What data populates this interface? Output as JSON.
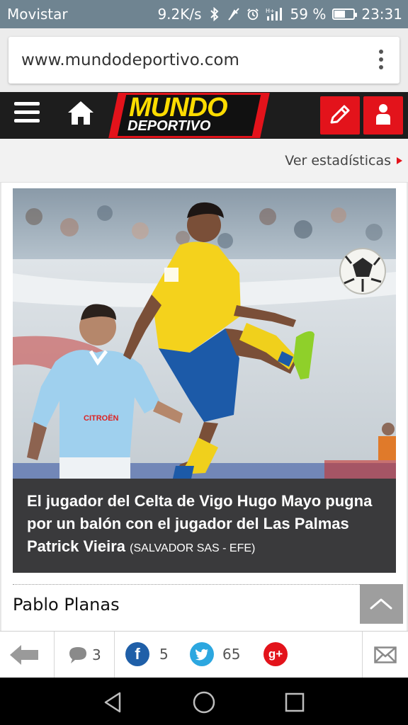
{
  "status_bar": {
    "carrier": "Movistar",
    "speed": "9.2K/s",
    "network": "H+",
    "battery_percent": "59 %",
    "battery_level": 0.59,
    "time": "23:31"
  },
  "browser": {
    "url": "www.mundodeportivo.com"
  },
  "site_header": {
    "logo_line1": "MUNDO",
    "logo_line2": "DEPORTIVO"
  },
  "stats": {
    "link_label": "Ver estadísticas"
  },
  "article": {
    "caption": "El jugador del Celta de Vigo Hugo Mayo pugna por un balón con el jugador del Las Palmas Patrick Vieira",
    "credit": "(SALVADOR SAS - EFE)",
    "author": "Pablo Planas",
    "shirt_sponsor": "CITROËN"
  },
  "share_bar": {
    "comments": "3",
    "facebook": "5",
    "twitter": "65"
  },
  "colors": {
    "brand_red": "#e3131b",
    "logo_yellow": "#ffdc00",
    "facebook": "#1f5fa8",
    "twitter": "#2ca7e0",
    "google_plus": "#e3131b"
  }
}
